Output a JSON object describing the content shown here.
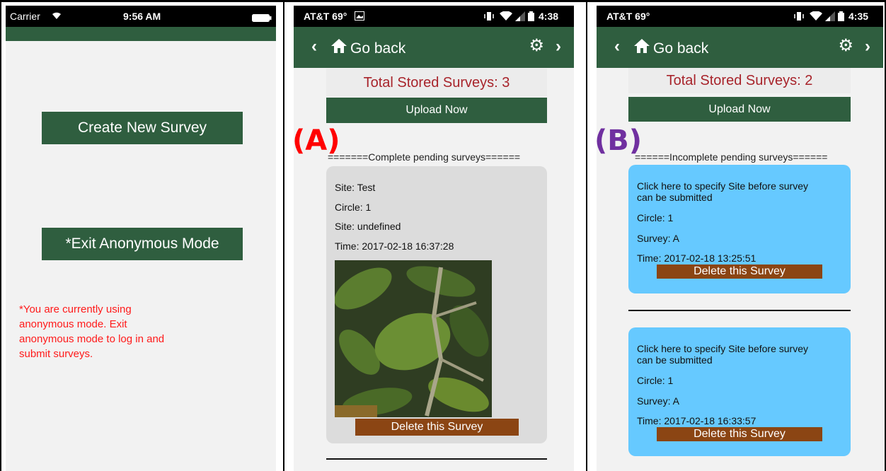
{
  "panel_a": {
    "status": {
      "carrier": "Carrier",
      "time": "9:56 AM"
    },
    "create_button": "Create New Survey",
    "exit_button": "*Exit Anonymous Mode",
    "notice_lines": [
      "*You are currently using",
      "anonymous mode. Exit",
      "anonymous mode to log in and",
      "submit surveys."
    ]
  },
  "panel_b": {
    "status": {
      "carrier": "AT&T 69°",
      "time": "4:38"
    },
    "nav": {
      "back_label": "Go back"
    },
    "total": "Total Stored Surveys: 3",
    "upload": "Upload Now",
    "overlay_label": "(A)",
    "section": "=======Complete pending surveys======",
    "card": {
      "lines": [
        "Site: Test",
        "Circle: 1",
        "Site: undefined",
        "Time: 2017-02-18 16:37:28"
      ],
      "delete": "Delete this Survey"
    }
  },
  "panel_c": {
    "status": {
      "carrier": "AT&T 69°",
      "time": "4:35"
    },
    "nav": {
      "back_label": "Go back"
    },
    "total": "Total Stored Surveys: 2",
    "upload": "Upload Now",
    "overlay_label": "(B)",
    "section": "======Incomplete pending surveys======",
    "cards": [
      {
        "lines": [
          "Click here to specify Site before survey",
          "can be submitted",
          "Circle: 1",
          "Survey: A",
          "Time: 2017-02-18 13:25:51"
        ],
        "delete": "Delete this Survey"
      },
      {
        "lines": [
          "Click here to specify Site before survey",
          "can be submitted",
          "Circle: 1",
          "Survey: A",
          "Time: 2017-02-18 16:33:57"
        ],
        "delete": "Delete this Survey"
      }
    ]
  },
  "colors": {
    "nav_green": "#2f5e3f",
    "total_red": "#a8242b",
    "notice_red": "#ff1a1a",
    "delete_brown": "#8b4513",
    "incomplete_card": "#66c9ff",
    "complete_card": "#dcdcdc",
    "label_a": "#ff0000",
    "label_b": "#7030a0"
  }
}
